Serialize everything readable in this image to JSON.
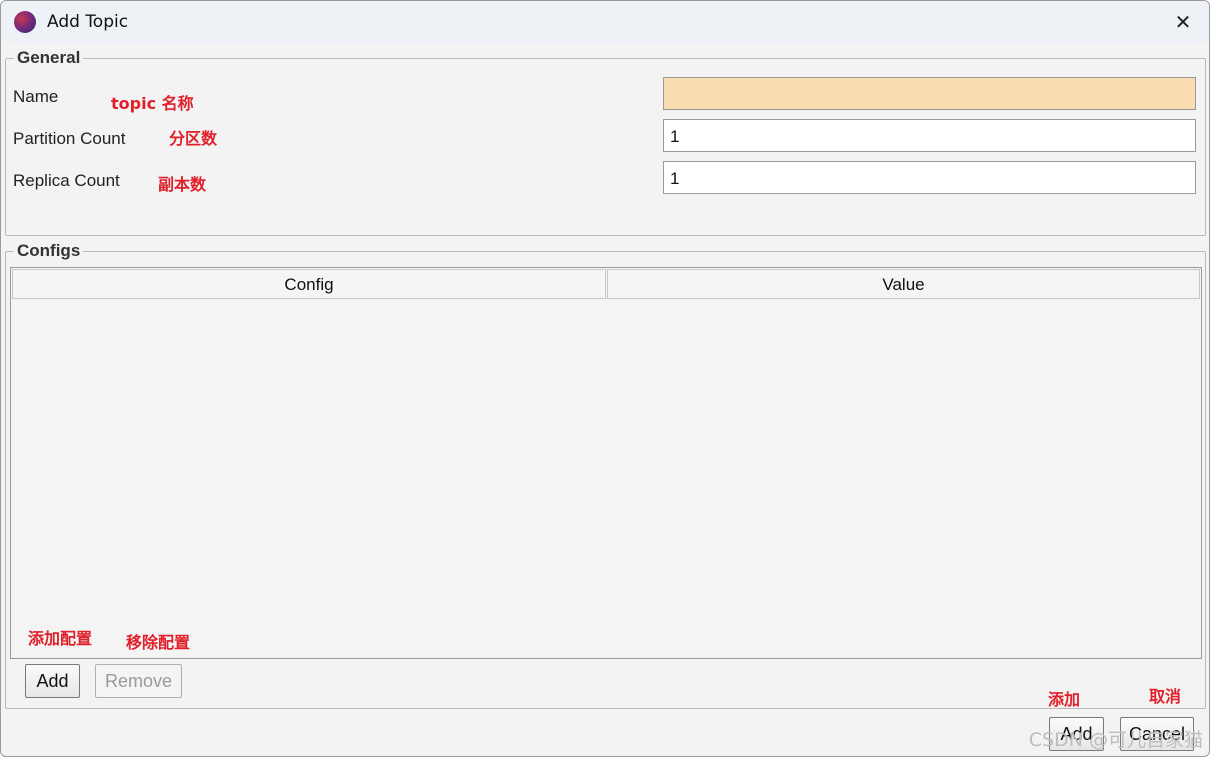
{
  "window": {
    "title": "Add Topic",
    "close_glyph": "✕"
  },
  "general": {
    "legend": "General",
    "name_label": "Name",
    "name_value": "",
    "partition_label": "Partition Count",
    "partition_value": "1",
    "replica_label": "Replica Count",
    "replica_value": "1"
  },
  "configs": {
    "legend": "Configs",
    "columns": [
      "Config",
      "Value"
    ],
    "add_label": "Add",
    "remove_label": "Remove"
  },
  "footer": {
    "add_label": "Add",
    "cancel_label": "Cancel"
  },
  "annotations": {
    "name": "topic 名称",
    "partition": "分区数",
    "replica": "副本数",
    "add_config": "添加配置",
    "remove_config": "移除配置",
    "add": "添加",
    "cancel": "取消"
  },
  "watermark": "CSDN @可儿自家猫",
  "colors": {
    "annotation": "#e0202a",
    "name_field_bg": "#f9dcb0"
  }
}
